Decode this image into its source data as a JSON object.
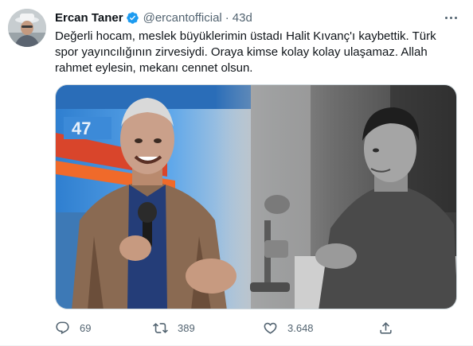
{
  "author": {
    "name": "Ercan Taner",
    "handle": "@ercantofficial",
    "separator": "·",
    "time": "43d"
  },
  "tweet": {
    "lines": [
      "Değerli hocam, meslek büyüklerimin üstadı Halit Kıvanç'ı kaybettik. Türk",
      "spor yayıncılığının zirvesiydi. Oraya kimse kolay kolay ulaşamaz. Allah",
      "rahmet eylesin, mekanı cennet olsun."
    ]
  },
  "media": {
    "left_panel_text": "47"
  },
  "actions": {
    "replies": "69",
    "retweets": "389",
    "likes": "3.648"
  },
  "icons": {
    "verified": "verified-badge-icon",
    "more": "more-icon",
    "reply": "reply-icon",
    "retweet": "retweet-icon",
    "like": "heart-icon",
    "share": "share-icon"
  },
  "colors": {
    "text": "#0f1419",
    "secondary": "#536471",
    "verified": "#1d9bf0"
  }
}
